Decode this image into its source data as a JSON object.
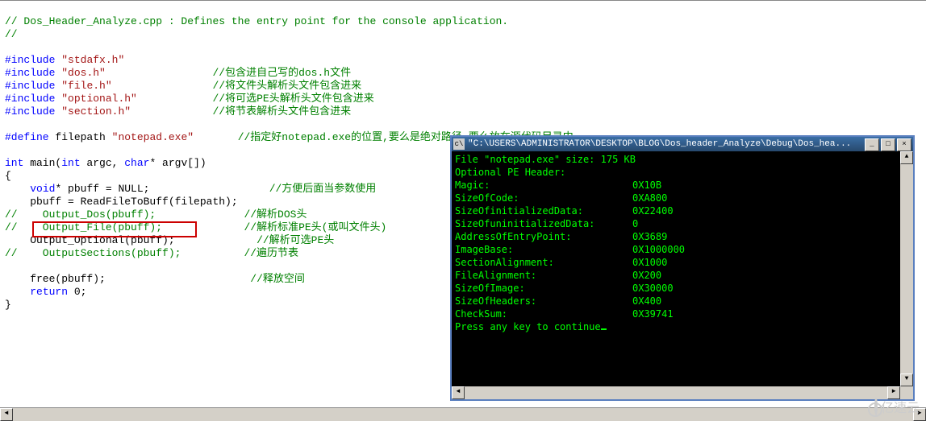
{
  "code": {
    "l1": "// Dos_Header_Analyze.cpp : Defines the entry point for the console application.",
    "l2": "//",
    "inc1q": "\"stdafx.h\"",
    "inc2q": "\"dos.h\"",
    "inc2c": "//包含进自己写的dos.h文件",
    "inc3q": "\"file.h\"",
    "inc3c": "//将文件头解析头文件包含进来",
    "inc4q": "\"optional.h\"",
    "inc4c": "//将可选PE头解析头文件包含进来",
    "inc5q": "\"section.h\"",
    "inc5c": "//将节表解析头文件包含进来",
    "def_kw": "#define",
    "def_name": "filepath",
    "def_val": "\"notepad.exe\"",
    "def_c": "//指定好notepad.exe的位置,要么是绝对路径,要么放在源代码目录中",
    "kw_include": "#include",
    "kw_int": "int",
    "kw_char": "char",
    "kw_void": "void",
    "kw_return": "return",
    "fn_main": " main(",
    "fn_argc": " argc, ",
    "fn_argv": "* argv[])",
    "obrace": "{",
    "cbrace": "}",
    "b1": "* pbuff = NULL;",
    "b1c": "//方便后面当参数使用",
    "b2": "    pbuff = ReadFileToBuff(filepath);",
    "b3": "//    Output_Dos(pbuff);",
    "b3c": "//解析DOS头",
    "b4": "//    Output_File(pbuff);",
    "b4c": "//解析标准PE头(或叫文件头)",
    "b5": "    Output_Optional(pbuff);",
    "b5c": "//解析可选PE头",
    "b6": "//    OutputSections(pbuff);",
    "b6c": "//遍历节表",
    "b7": "    free(pbuff);",
    "b7c": "//释放空间",
    "b8": " 0;"
  },
  "console": {
    "title": "\"C:\\USERS\\ADMINISTRATOR\\DESKTOP\\BLOG\\Dos_header_Analyze\\Debug\\Dos_hea...",
    "l1": "File \"notepad.exe\" size: 175 KB",
    "l2": "Optional PE Header:",
    "rows": [
      {
        "k": "Magic:",
        "v": "0X10B"
      },
      {
        "k": "SizeOfCode:",
        "v": "0XA800"
      },
      {
        "k": "SizeOfinitializedData:",
        "v": "0X22400"
      },
      {
        "k": "SizeOfuninitializedData:",
        "v": "0"
      },
      {
        "k": "AddressOfEntryPoint:",
        "v": "0X3689"
      },
      {
        "k": "ImageBase:",
        "v": "0X1000000"
      },
      {
        "k": "SectionAlignment:",
        "v": "0X1000"
      },
      {
        "k": "FileAlignment:",
        "v": "0X200"
      },
      {
        "k": "SizeOfImage:",
        "v": "0X30000"
      },
      {
        "k": "SizeOfHeaders:",
        "v": "0X400"
      },
      {
        "k": "CheckSum:",
        "v": "0X39741"
      }
    ],
    "cont": "Press any key to continue"
  },
  "watermark": "亿速云"
}
